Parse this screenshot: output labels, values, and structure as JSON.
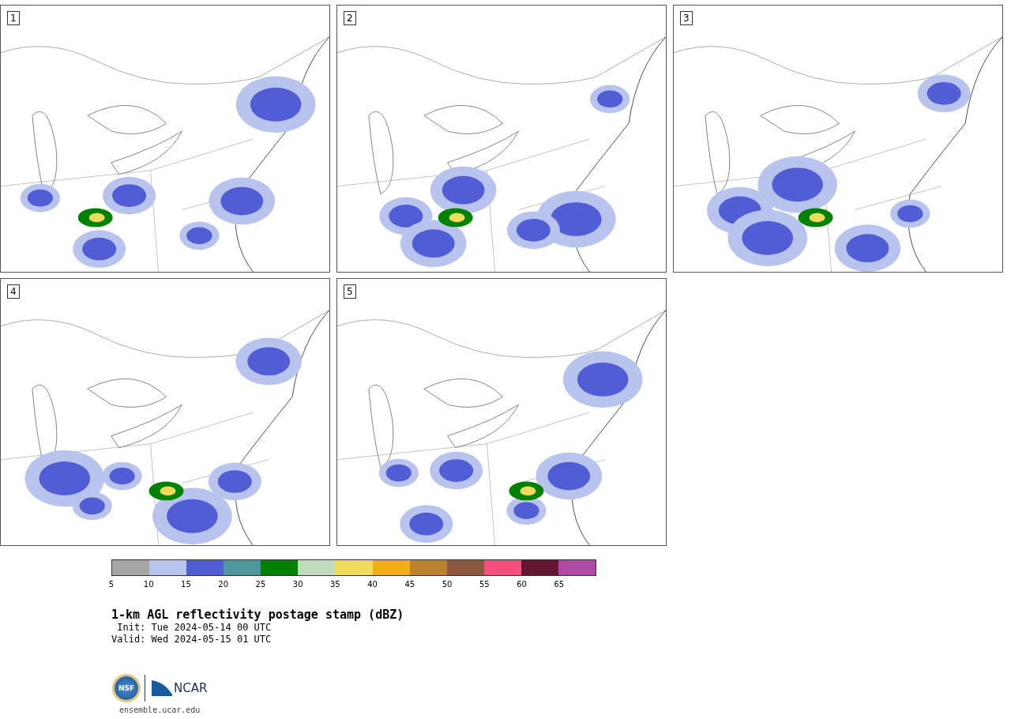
{
  "panels": [
    {
      "label": "1"
    },
    {
      "label": "2"
    },
    {
      "label": "3"
    },
    {
      "label": "4"
    },
    {
      "label": "5"
    }
  ],
  "colorbar": {
    "segments": [
      {
        "color": "#a5a5a5"
      },
      {
        "color": "#b8c3ee"
      },
      {
        "color": "#505dd5"
      },
      {
        "color": "#4f979c"
      },
      {
        "color": "#008100"
      },
      {
        "color": "#bedcbb"
      },
      {
        "color": "#eedb5a"
      },
      {
        "color": "#f0ae16"
      },
      {
        "color": "#b98230"
      },
      {
        "color": "#8b573f"
      },
      {
        "color": "#f5507d"
      },
      {
        "color": "#631734"
      },
      {
        "color": "#ae4aa6"
      }
    ],
    "tick_labels": [
      "5",
      "10",
      "15",
      "20",
      "25",
      "30",
      "35",
      "40",
      "45",
      "50",
      "55",
      "60",
      "65"
    ]
  },
  "title": "1-km AGL reflectivity postage stamp (dBZ)",
  "init": " Init: Tue 2024-05-14 00 UTC",
  "valid": "Valid: Wed 2024-05-15 01 UTC",
  "logos": {
    "nsf": "NSF",
    "ncar": "NCAR"
  },
  "site": "ensemble.ucar.edu"
}
